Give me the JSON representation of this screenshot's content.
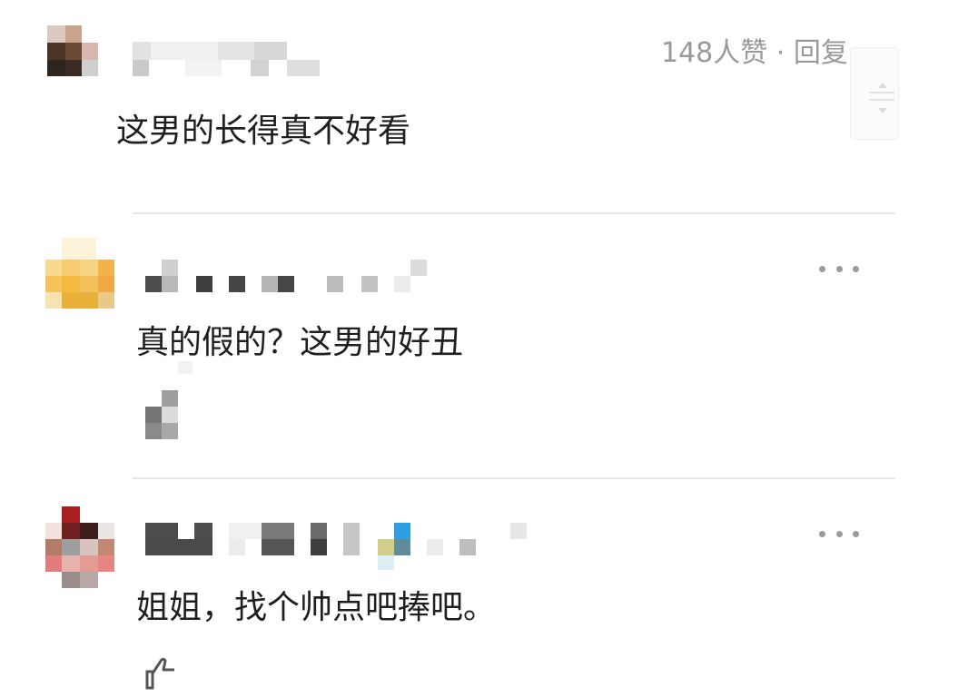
{
  "comments": [
    {
      "likes_reply": "148人赞 · 回复",
      "text": "这男的长得真不好看"
    },
    {
      "text": "真的假的？这男的好丑"
    },
    {
      "text": "姐姐，找个帅点吧捧吧。"
    }
  ],
  "icons": {
    "more": "more-horizontal-icon",
    "like": "thumbs-up-icon",
    "scroll": "scroll-handle-icon"
  }
}
